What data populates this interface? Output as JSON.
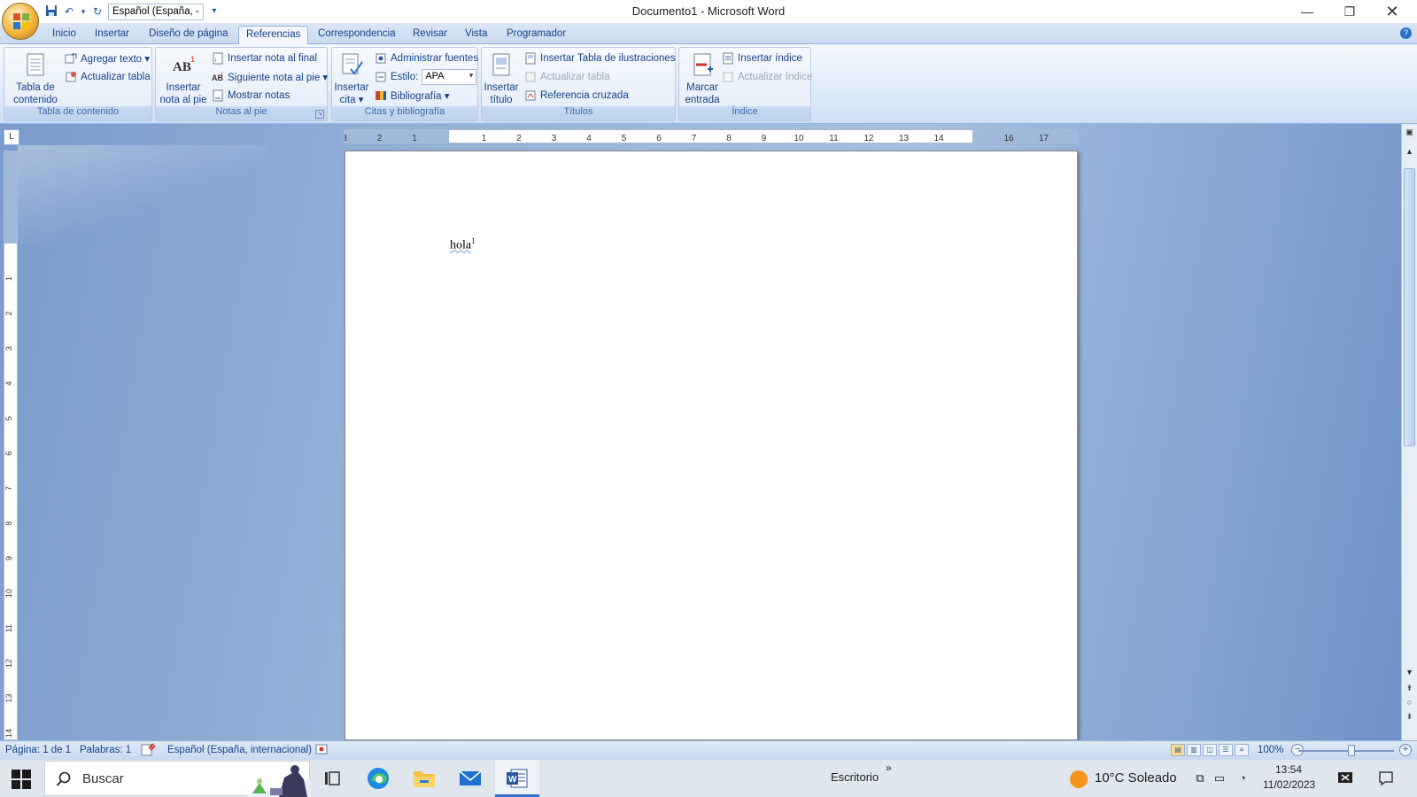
{
  "app": {
    "title": "Documento1 - Microsoft Word",
    "quick_access": {
      "language": "Español (España, -"
    }
  },
  "tabs": [
    "Inicio",
    "Insertar",
    "Diseño de página",
    "Referencias",
    "Correspondencia",
    "Revisar",
    "Vista",
    "Programador"
  ],
  "active_tab": "Referencias",
  "ribbon": {
    "toc": {
      "label": "Tabla de contenido",
      "big_button": "Tabla de contenido ▾",
      "add_text": "Agregar texto ▾",
      "update_table": "Actualizar tabla"
    },
    "footnotes": {
      "label": "Notas al pie",
      "big_button": "Insertar nota al pie",
      "insert_endnote": "Insertar nota al final",
      "next_footnote": "Siguiente nota al pie ▾",
      "show_notes": "Mostrar notas"
    },
    "citations": {
      "label": "Citas y bibliografía",
      "big_button": "Insertar cita ▾",
      "manage_sources": "Administrar fuentes",
      "style_label": "Estilo:",
      "style_value": "APA",
      "bibliography": "Bibliografía ▾"
    },
    "captions": {
      "label": "Títulos",
      "big_button": "Insertar título",
      "insert_table_figures": "Insertar Tabla de ilustraciones",
      "update_table": "Actualizar tabla",
      "cross_reference": "Referencia cruzada"
    },
    "index": {
      "label": "Índice",
      "big_button": "Marcar entrada",
      "insert_index": "Insertar índice",
      "update_index": "Actualizar índice"
    }
  },
  "ruler": {
    "corner": "L",
    "h_ticks": [
      "3",
      "2",
      "1",
      "1",
      "2",
      "3",
      "4",
      "5",
      "6",
      "7",
      "8",
      "9",
      "10",
      "11",
      "12",
      "13",
      "14",
      "16",
      "17"
    ],
    "v_ticks": [
      "2",
      "1",
      "1",
      "2",
      "3",
      "4",
      "5",
      "6",
      "7",
      "8",
      "9",
      "10",
      "11",
      "12",
      "13",
      "14"
    ]
  },
  "document": {
    "text": "hola",
    "footnote_ref": "1"
  },
  "statusbar": {
    "page": "Página: 1 de 1",
    "words": "Palabras: 1",
    "language": "Español (España, internacional)",
    "zoom": "100%"
  },
  "taskbar": {
    "search_placeholder": "Buscar",
    "desktop_label": "Escritorio",
    "weather": "10°C  Soleado",
    "time": "13:54",
    "date": "11/02/2023"
  }
}
